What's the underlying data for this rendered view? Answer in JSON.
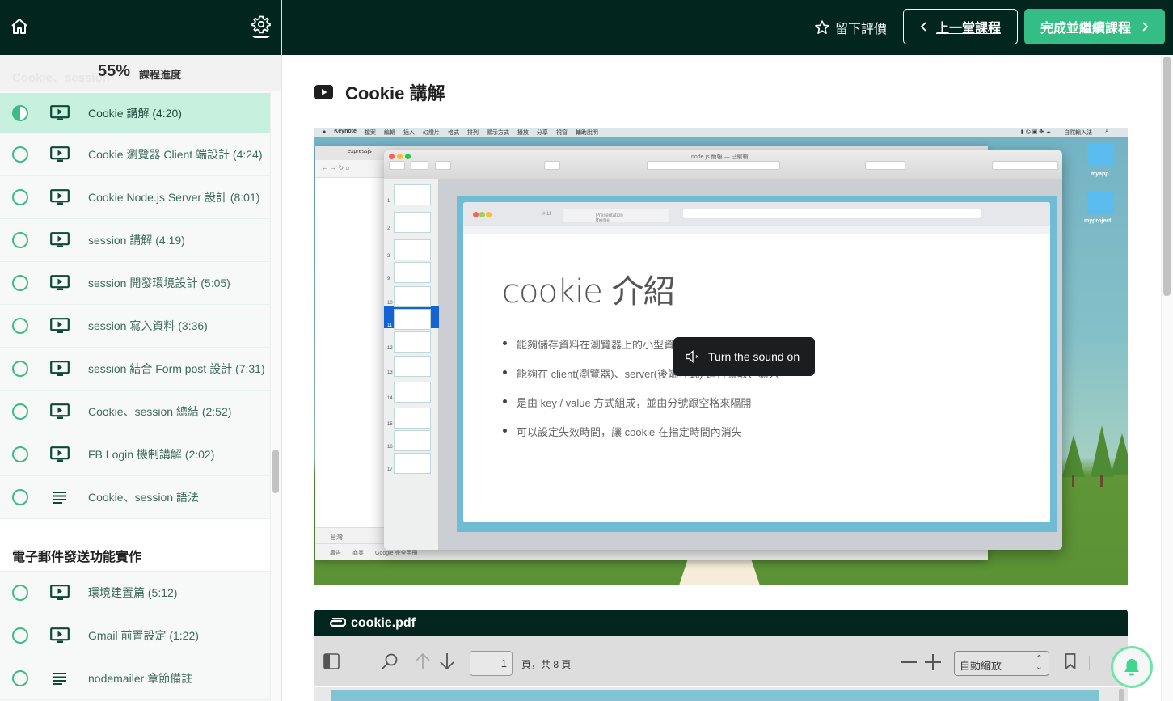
{
  "sidebar": {
    "progress_percent": "55%",
    "progress_label": "課程進度",
    "ghost_section": "Cookie、session",
    "lessons_group1": [
      {
        "title": "Cookie 講解 (4:20)",
        "type": "video",
        "status": "in-progress",
        "active": true
      },
      {
        "title": "Cookie 瀏覽器 Client 端設計 (4:24)",
        "type": "video",
        "status": "not-started"
      },
      {
        "title": "Cookie Node.js Server 設計 (8:01)",
        "type": "video",
        "status": "not-started"
      },
      {
        "title": "session 講解 (4:19)",
        "type": "video",
        "status": "not-started"
      },
      {
        "title": "session 開發環境設計 (5:05)",
        "type": "video",
        "status": "not-started"
      },
      {
        "title": "session 寫入資料 (3:36)",
        "type": "video",
        "status": "not-started"
      },
      {
        "title": "session 結合 Form post 設計 (7:31)",
        "type": "video",
        "status": "not-started"
      },
      {
        "title": "Cookie、session 總結 (2:52)",
        "type": "video",
        "status": "not-started"
      },
      {
        "title": "FB Login 機制講解 (2:02)",
        "type": "video",
        "status": "not-started"
      },
      {
        "title": "Cookie、session 語法",
        "type": "text",
        "status": "not-started"
      }
    ],
    "section2_title": "電子郵件發送功能實作",
    "lessons_group2": [
      {
        "title": "環境建置篇 (5:12)",
        "type": "video",
        "status": "not-started"
      },
      {
        "title": "Gmail 前置設定 (1:22)",
        "type": "video",
        "status": "not-started"
      },
      {
        "title": "nodemailer 章節備註",
        "type": "text",
        "status": "not-started"
      }
    ]
  },
  "topbar": {
    "rate_label": "留下評價",
    "prev_label": "上一堂課程",
    "next_label": "完成並繼續課程"
  },
  "lecture": {
    "title": "Cookie 講解"
  },
  "video": {
    "menubar": [
      "Keynote",
      "檔案",
      "編輯",
      "插入",
      "幻燈片",
      "格式",
      "排列",
      "顯示方式",
      "播放",
      "分享",
      "視窗",
      "輔助說明"
    ],
    "menubar_right": "自然輸入法",
    "keynote_doc_title": "node.js 簡報 — 已編輯",
    "browser_tab": "expressjs",
    "browser_footer_region": "台灣",
    "browser_footer_links": [
      "廣告",
      "商業",
      "Google 完全手冊"
    ],
    "desktop_folders": [
      "myapp",
      "myproject"
    ],
    "thumbnail_numbers": [
      "1",
      "2",
      "3",
      "9",
      "10",
      "11",
      "12",
      "13",
      "14",
      "15",
      "16",
      "17"
    ],
    "slide_chrome_tab": "Presentation theme",
    "slide_chrome_num": "# 11",
    "slide_heading": "cookie 介紹",
    "slide_bullets": [
      "能夠儲存資料在瀏覽器上的小型資料",
      "能夠在 client(瀏覽器)、server(後端程式) 進行讀取、寫入",
      "是由 key / value 方式組成，並由分號跟空格來隔開",
      "可以設定失效時間，讓 cookie 在指定時間內消失"
    ],
    "sound_label": "Turn the sound on"
  },
  "pdf": {
    "filename": "cookie.pdf",
    "page_value": "1",
    "page_total": "頁，共 8 頁",
    "zoom_value": "自動縮放"
  },
  "colors": {
    "header_bg": "#02261d",
    "accent_green": "#34bd84",
    "active_lesson_bg": "#c8f0de",
    "bell_ring": "#6ee3aa"
  }
}
